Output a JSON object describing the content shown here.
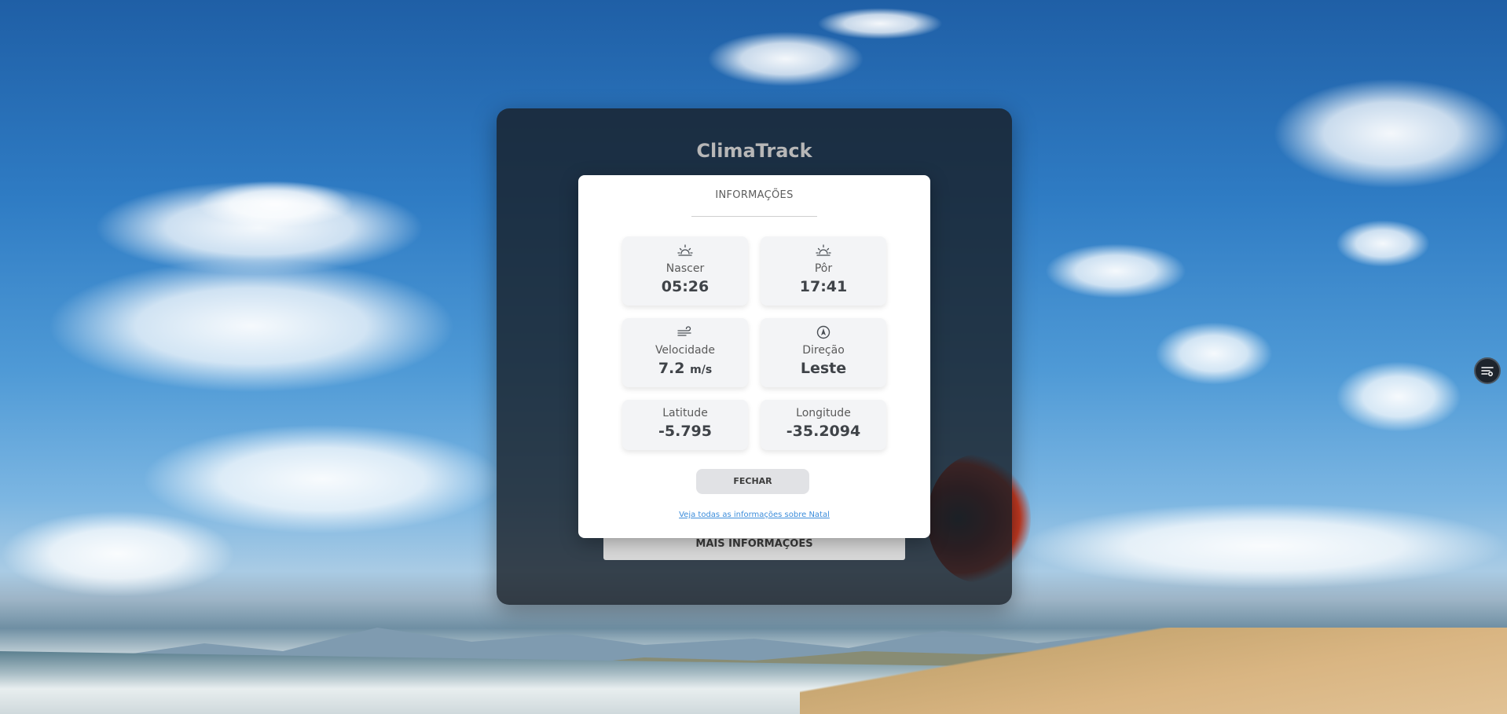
{
  "app": {
    "title": "ClimaTrack",
    "more_button_label": "MAIS INFORMAÇÕES"
  },
  "modal": {
    "title": "INFORMAÇÕES",
    "tiles": [
      {
        "label": "Nascer",
        "value": "05:26",
        "icon": "sunrise-icon"
      },
      {
        "label": "Pôr",
        "value": "17:41",
        "icon": "sunset-icon"
      },
      {
        "label": "Velocidade",
        "value": "7.2",
        "unit": "m/s",
        "icon": "wind-icon"
      },
      {
        "label": "Direção",
        "value": "Leste",
        "icon": "compass-icon"
      },
      {
        "label": "Latitude",
        "value": "-5.795"
      },
      {
        "label": "Longitude",
        "value": "-35.2094"
      }
    ],
    "close_label": "FECHAR",
    "link_text": "Veja todas as informações sobre Natal"
  },
  "floating_button": {
    "icon": "settings-sliders-icon"
  },
  "colors": {
    "overlay": "#181e26",
    "modal_bg": "#ffffff",
    "tile_bg": "#f3f4f6",
    "link": "#3c8ddb"
  }
}
